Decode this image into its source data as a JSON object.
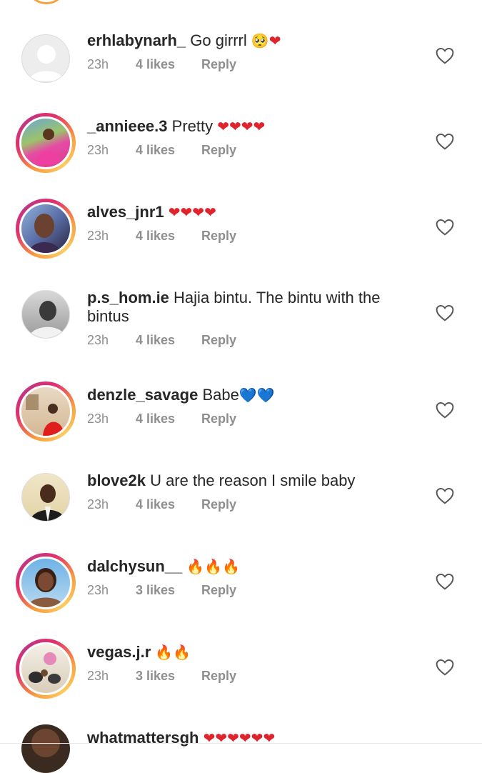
{
  "comments": [
    {
      "username": "erhlabynarh_",
      "text": "Go girrrl",
      "emojis": [
        "pleading-face",
        "red-heart"
      ],
      "emoji_chars": [
        "🥺",
        "❤"
      ],
      "time": "23h",
      "likes": "4 likes",
      "reply": "Reply",
      "has_story": false,
      "avatar": "default-avatar"
    },
    {
      "username": "_annieee.3",
      "text": "Pretty",
      "emojis": [
        "red-heart",
        "red-heart",
        "red-heart",
        "red-heart"
      ],
      "emoji_chars": [
        "❤",
        "❤",
        "❤",
        "❤"
      ],
      "time": "23h",
      "likes": "4 likes",
      "reply": "Reply",
      "has_story": true,
      "avatar": "photo-pink-outfit"
    },
    {
      "username": "alves_jnr1",
      "text": "",
      "emojis": [
        "red-heart",
        "red-heart",
        "red-heart",
        "red-heart"
      ],
      "emoji_chars": [
        "❤",
        "❤",
        "❤",
        "❤"
      ],
      "time": "23h",
      "likes": "4 likes",
      "reply": "Reply",
      "has_story": true,
      "avatar": "photo-selfie"
    },
    {
      "username": "p.s_hom.ie",
      "text": "Hajia bintu.  The bintu with the bintus",
      "emojis": [],
      "emoji_chars": [],
      "time": "23h",
      "likes": "4 likes",
      "reply": "Reply",
      "has_story": false,
      "avatar": "photo-bw-portrait"
    },
    {
      "username": "denzle_savage",
      "text": "Babe",
      "emojis": [
        "blue-heart",
        "blue-heart"
      ],
      "emoji_chars": [
        "💙",
        "💙"
      ],
      "time": "23h",
      "likes": "4 likes",
      "reply": "Reply",
      "has_story": true,
      "avatar": "photo-red-shirt"
    },
    {
      "username": "blove2k",
      "text": "U are the reason I smile baby",
      "emojis": [],
      "emoji_chars": [],
      "time": "23h",
      "likes": "4 likes",
      "reply": "Reply",
      "has_story": false,
      "avatar": "photo-suit"
    },
    {
      "username": "dalchysun__",
      "text": "",
      "emojis": [
        "fire",
        "fire",
        "fire"
      ],
      "emoji_chars": [
        "🔥",
        "🔥",
        "🔥"
      ],
      "time": "23h",
      "likes": "3 likes",
      "reply": "Reply",
      "has_story": true,
      "avatar": "photo-woman"
    },
    {
      "username": "vegas.j.r",
      "text": "",
      "emojis": [
        "fire",
        "fire"
      ],
      "emoji_chars": [
        "🔥",
        "🔥"
      ],
      "time": "23h",
      "likes": "3 likes",
      "reply": "Reply",
      "has_story": true,
      "avatar": "photo-drums"
    },
    {
      "username": "whatmattersgh",
      "text": "",
      "emojis": [
        "red-heart",
        "red-heart",
        "red-heart",
        "red-heart",
        "red-heart",
        "red-heart"
      ],
      "emoji_chars": [
        "❤",
        "❤",
        "❤",
        "❤",
        "❤",
        "❤"
      ],
      "time": "",
      "likes": "",
      "reply": "",
      "has_story": false,
      "avatar": "photo-partial"
    }
  ],
  "like_icon": "heart-outline-icon",
  "colors": {
    "username": "#262626",
    "meta": "#8e8e8e",
    "story_ring_orange": "#f9a03f",
    "story_ring_pink": "#e1306c",
    "heart_red": "#e0242e",
    "heart_blue": "#1d8ee6"
  }
}
